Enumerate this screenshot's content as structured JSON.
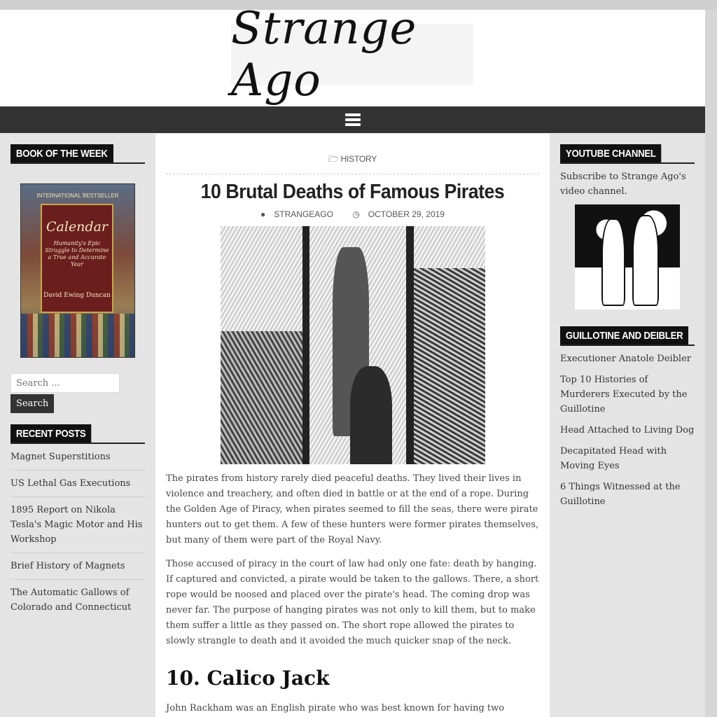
{
  "header": {
    "site_title": "Strange Ago"
  },
  "left_sidebar": {
    "book_widget_title": "Book of the Week",
    "book": {
      "badge": "INTERNATIONAL BESTSELLER",
      "title": "Calendar",
      "subtitle": "Humanity's Epic Struggle to Determine a True and Accurate Year",
      "author": "David Ewing Duncan"
    },
    "search": {
      "placeholder": "Search ...",
      "button_label": "Search"
    },
    "recent_posts_title": "Recent Posts",
    "recent_posts": [
      "Magnet Superstitions",
      "US Lethal Gas Executions",
      "1895 Report on Nikola Tesla's Magic Motor and His Workshop",
      "Brief History of Magnets",
      "The Automatic Gallows of Colorado and Connecticut"
    ]
  },
  "article": {
    "category": "HISTORY",
    "title": "10 Brutal Deaths of Famous Pirates",
    "author": "STRANGEAGO",
    "date": "OCTOBER 29, 2019",
    "paragraphs": [
      "The pirates from history rarely died peaceful deaths. They lived their lives in violence and treachery, and often died in battle or at the end of a rope. During the Golden Age of Piracy, when pirates seemed to fill the seas, there were pirate hunters out to get them. A few of these hunters were former pirates themselves, but many of them were part of the Royal Navy.",
      "Those accused of piracy in the court of law had only one fate: death by hanging. If captured and convicted, a pirate would be taken to the gallows. There, a short rope would be noosed and placed over the pirate's head. The coming drop was never far. The purpose of hanging pirates was not only to kill them, but to make them suffer a little as they passed on. The short rope allowed the pirates to slowly strangle to death and it avoided the much quicker snap of the neck."
    ],
    "subheading": "10. Calico Jack",
    "paragraph_after": "John Rackham was an English pirate who was best known for having two women on his crew. The first was Anne Bonny, his lover, and then Mary Read who joined his"
  },
  "right_sidebar": {
    "youtube_title": "YouTube Channel",
    "youtube_text": "Subscribe to Strange Ago's video channel.",
    "guillotine_title": "Guillotine and Deibler",
    "guillotine_links": [
      "Executioner Anatole Deibler",
      "Top 10 Histories of Murderers Executed by the Guillotine",
      "Head Attached to Living Dog",
      "Decapitated Head with Moving Eyes",
      "6 Things Witnessed at the Guillotine"
    ]
  },
  "icons": {
    "menu": "hamburger-icon",
    "category": "folder-icon",
    "author": "user-icon",
    "date": "clock-icon"
  }
}
